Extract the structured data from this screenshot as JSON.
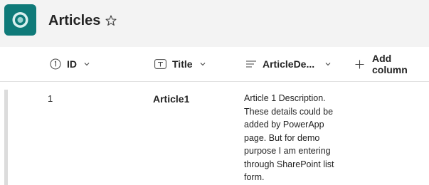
{
  "header": {
    "title": "Articles",
    "app_icon": "sharepoint-list-icon",
    "favorite_icon": "star-outline-icon",
    "accent_color": "#0f7a79"
  },
  "columns": [
    {
      "label": "ID",
      "icon": "number-circle-icon"
    },
    {
      "label": "Title",
      "icon": "text-field-icon"
    },
    {
      "label": "ArticleDe...",
      "icon": "multiline-text-icon"
    }
  ],
  "add_column": {
    "label": "Add column",
    "icon": "plus-icon"
  },
  "rows": [
    {
      "id": "1",
      "title": "Article1",
      "description": "Article 1 Description. These details could be added by PowerApp page. But for demo purpose I am entering through SharePoint list form."
    }
  ]
}
